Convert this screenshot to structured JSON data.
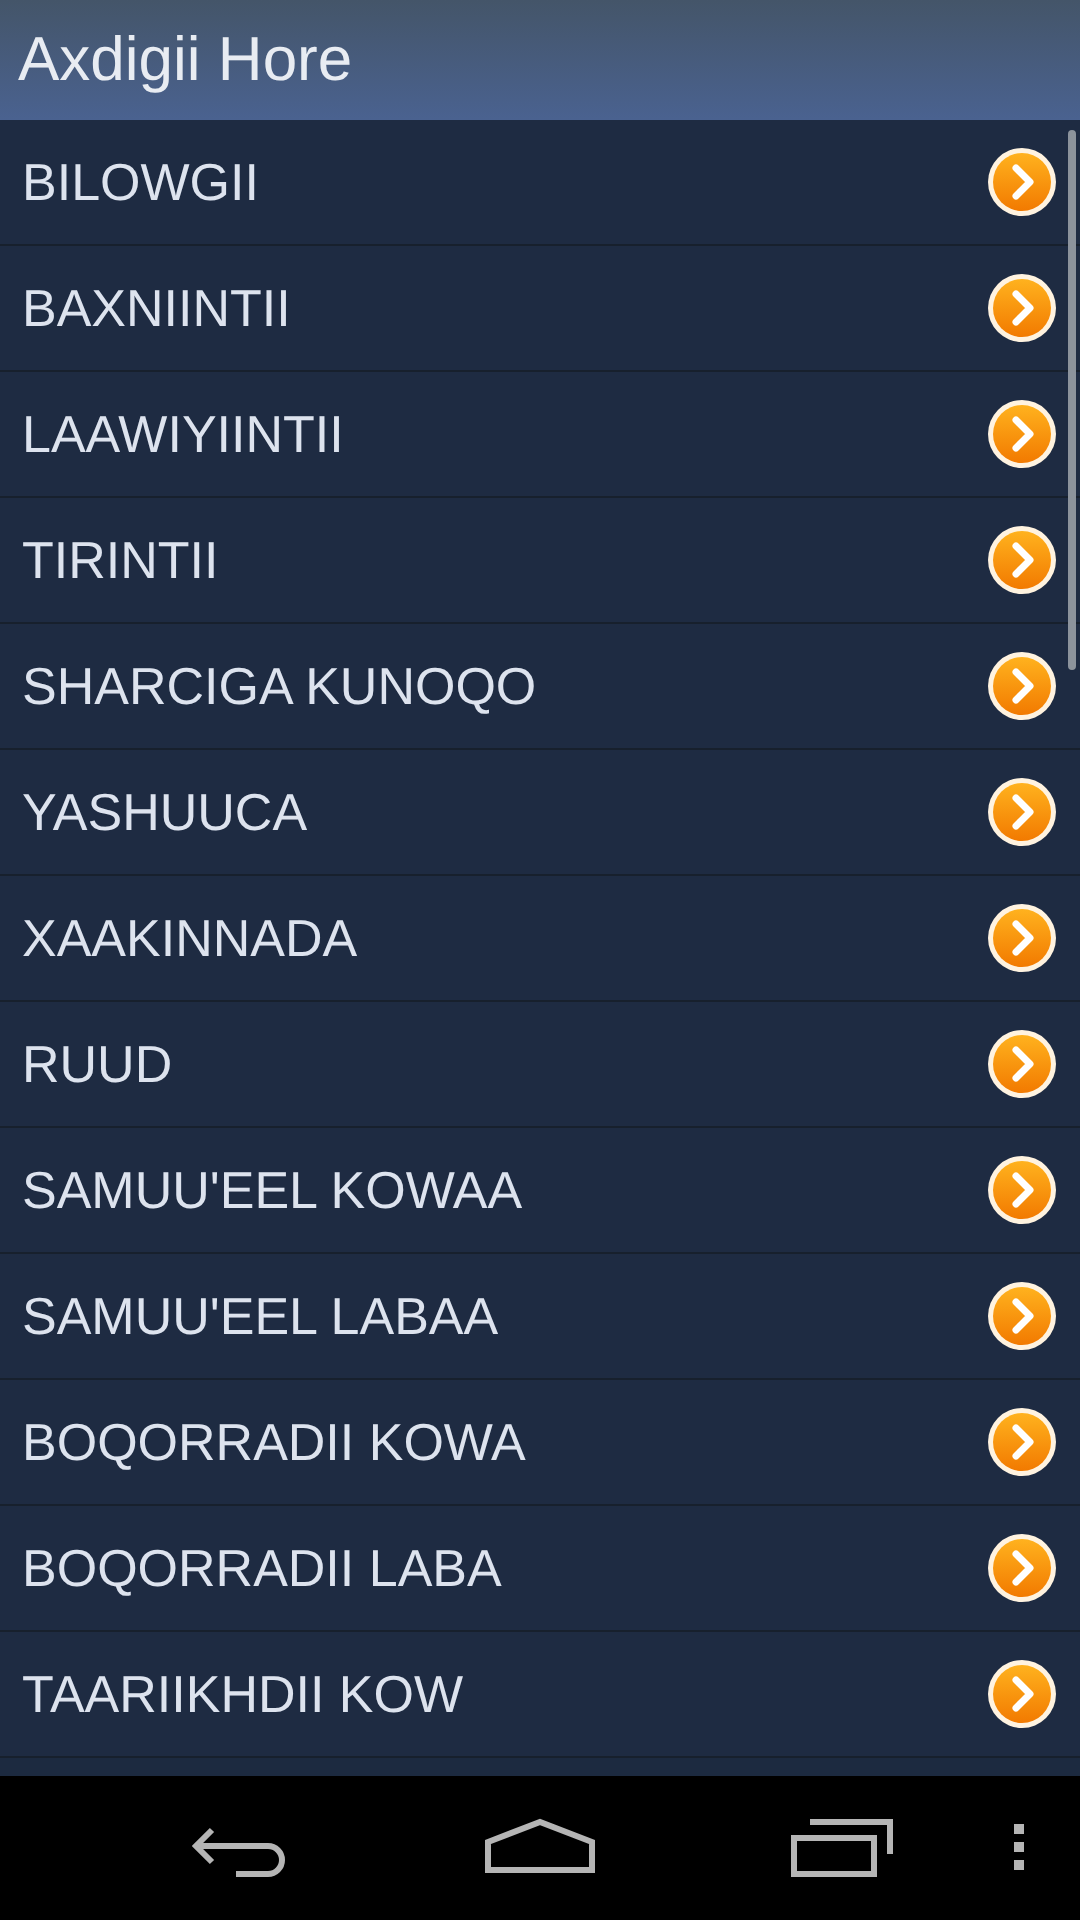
{
  "title": "Axdigii Hore",
  "books": [
    {
      "label": "BILOWGII"
    },
    {
      "label": "BAXNIINTII"
    },
    {
      "label": "LAAWIYIINTII"
    },
    {
      "label": "TIRINTII"
    },
    {
      "label": "SHARCIGA KUNOQO"
    },
    {
      "label": "YASHUUCA"
    },
    {
      "label": "XAAKINNADA"
    },
    {
      "label": "RUUD"
    },
    {
      "label": "SAMUU'EEL KOWAA"
    },
    {
      "label": "SAMUU'EEL LABAA"
    },
    {
      "label": "BOQORRADII KOWA"
    },
    {
      "label": "BOQORRADII LABA"
    },
    {
      "label": "TAARIIKHDII KOW"
    }
  ]
}
